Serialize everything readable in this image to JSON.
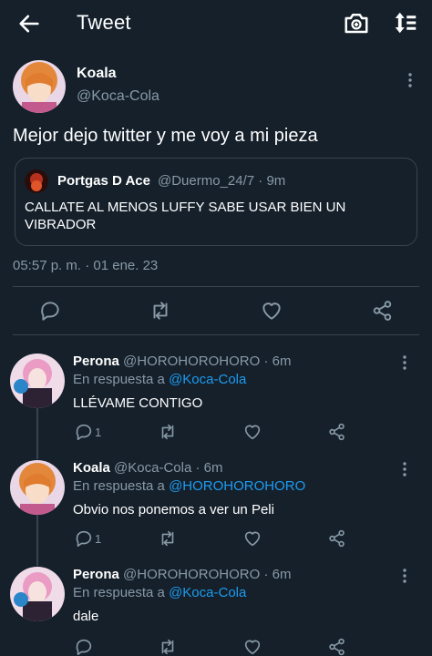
{
  "header": {
    "title": "Tweet",
    "back_icon": "arrow-left-icon",
    "camera_icon": "camera-plus-icon",
    "sort_icon": "sort-arrows-icon"
  },
  "main_tweet": {
    "name": "Koala",
    "handle": "@Koca-Cola",
    "text": "Mejor dejo twitter y me voy a mi pieza",
    "quote": {
      "name": "Portgas D Ace",
      "handle": "@Duermo_24/7",
      "time": "· 9m",
      "text": "CALLATE AL MENOS LUFFY SABE USAR BIEN UN VIBRADOR"
    },
    "timestamp": "05:57 p. m. · 01 ene. 23"
  },
  "replies": [
    {
      "name": "Perona",
      "handle": "@HOROHOROHORO",
      "time": "· 6m",
      "in_reply_prefix": "En respuesta a",
      "in_reply_to": "@Koca-Cola",
      "text": "LLÉVAME CONTIGO",
      "reply_count": "1"
    },
    {
      "name": "Koala",
      "handle": "@Koca-Cola",
      "time": "· 6m",
      "in_reply_prefix": "En respuesta a",
      "in_reply_to": "@HOROHOROHORO",
      "text": "Obvio nos ponemos a ver un Peli",
      "reply_count": "1"
    },
    {
      "name": "Perona",
      "handle": "@HOROHOROHORO",
      "time": "· 6m",
      "in_reply_prefix": "En respuesta a",
      "in_reply_to": "@Koca-Cola",
      "text": "dale",
      "reply_count": ""
    }
  ],
  "colors": {
    "background": "#15202b",
    "border": "#38444d",
    "muted": "#8899a6",
    "accent": "#1d9bf0"
  }
}
